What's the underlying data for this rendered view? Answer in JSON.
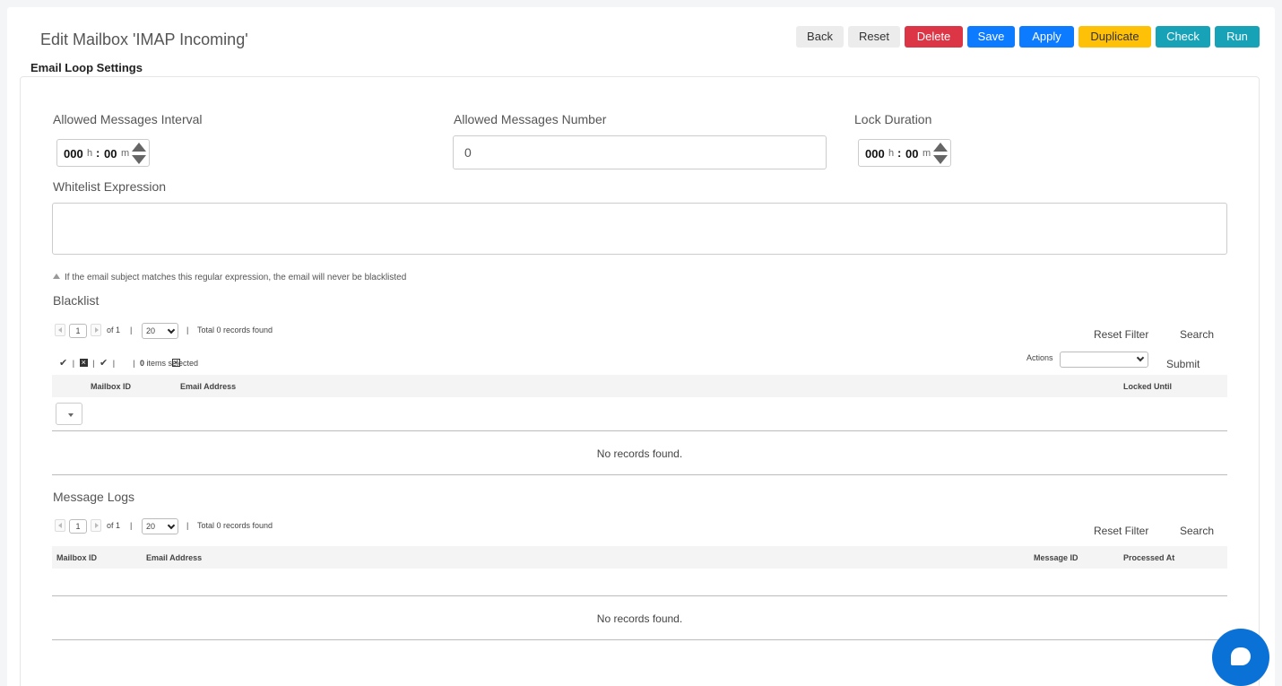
{
  "header": {
    "title": "Edit Mailbox 'IMAP Incoming'"
  },
  "toolbar": {
    "back": "Back",
    "reset": "Reset",
    "delete": "Delete",
    "save": "Save",
    "apply": "Apply",
    "duplicate": "Duplicate",
    "check": "Check",
    "run": "Run"
  },
  "section": {
    "title": "Email Loop Settings"
  },
  "form": {
    "interval_label": "Allowed Messages Interval",
    "interval_hours": "000",
    "interval_minutes": "00",
    "number_label": "Allowed Messages Number",
    "number_value": "0",
    "lock_label": "Lock Duration",
    "lock_hours": "000",
    "lock_minutes": "00",
    "hours_unit": "h",
    "minutes_unit": "m",
    "separator": ":",
    "whitelist_label": "Whitelist Expression",
    "whitelist_value": "",
    "whitelist_hint": "If the email subject matches this regular expression, the email will never be blacklisted"
  },
  "blacklist": {
    "title": "Blacklist",
    "page": "1",
    "of": "of 1",
    "sep": "|",
    "page_size": "20",
    "total": "Total 0 records found",
    "reset_filter": "Reset Filter",
    "search": "Search",
    "selected_count": "0",
    "items_selected": "items selected",
    "actions_label": "Actions",
    "submit": "Submit",
    "columns": [
      "Mailbox ID",
      "Email Address",
      "Locked Until"
    ],
    "empty": "No records found."
  },
  "logs": {
    "title": "Message Logs",
    "page": "1",
    "of": "of 1",
    "sep": "|",
    "page_size": "20",
    "total": "Total 0 records found",
    "reset_filter": "Reset Filter",
    "search": "Search",
    "columns": [
      "Mailbox ID",
      "Email Address",
      "Message ID",
      "Processed At"
    ],
    "empty": "No records found."
  },
  "colors": {
    "delete": "#dc3545",
    "primary": "#0d7bff",
    "warning": "#ffc107",
    "info": "#17a2b8",
    "chat": "#0a72d6"
  }
}
